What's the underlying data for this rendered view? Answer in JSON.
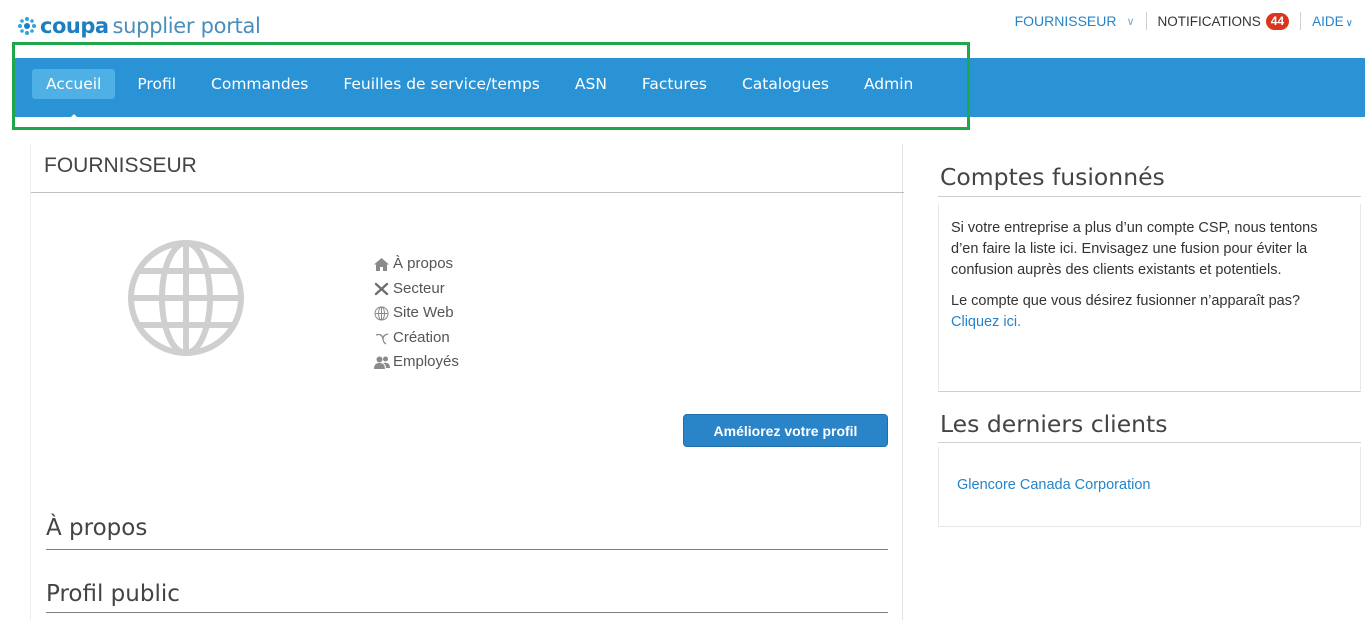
{
  "brand": {
    "name": "coupa",
    "product": "supplier portal",
    "logo_icon": "coupa-star-logo-icon"
  },
  "topbar": {
    "user_label": "FOURNISSEUR",
    "notifications_label": "NOTIFICATIONS",
    "notifications_count": "44",
    "help_label": "AIDE"
  },
  "nav": {
    "items": [
      {
        "label": "Accueil",
        "active": true
      },
      {
        "label": "Profil"
      },
      {
        "label": "Commandes"
      },
      {
        "label": "Feuilles de service/temps"
      },
      {
        "label": "ASN"
      },
      {
        "label": "Factures"
      },
      {
        "label": "Catalogues"
      },
      {
        "label": "Admin"
      }
    ]
  },
  "profile": {
    "title": "FOURNISSEUR",
    "info": [
      {
        "icon": "home-icon",
        "label": "À propos"
      },
      {
        "icon": "tools-icon",
        "label": "Secteur"
      },
      {
        "icon": "globe-small-icon",
        "label": "Site Web"
      },
      {
        "icon": "seedling-icon",
        "label": "Création"
      },
      {
        "icon": "users-icon",
        "label": "Employés"
      }
    ],
    "improve_button": "Améliorez votre profil",
    "sections": [
      "À propos",
      "Profil public"
    ]
  },
  "merged_accounts": {
    "title": "Comptes fusionnés",
    "text1": "Si votre entreprise a plus d’un compte CSP, nous tentons d’en faire la liste ici. Envisagez une fusion pour éviter la confusion auprès des clients existants et potentiels.",
    "text2": "Le compte que vous désirez fusionner n’apparaît pas?",
    "link": "Cliquez ici."
  },
  "latest_clients": {
    "title": "Les derniers clients",
    "items": [
      "Glencore Canada Corporation"
    ]
  },
  "colors": {
    "nav_bg": "#2a93d5",
    "nav_active": "#4fb0e6",
    "link": "#2584c9",
    "badge": "#d9361d",
    "highlight": "#1fa74a"
  }
}
